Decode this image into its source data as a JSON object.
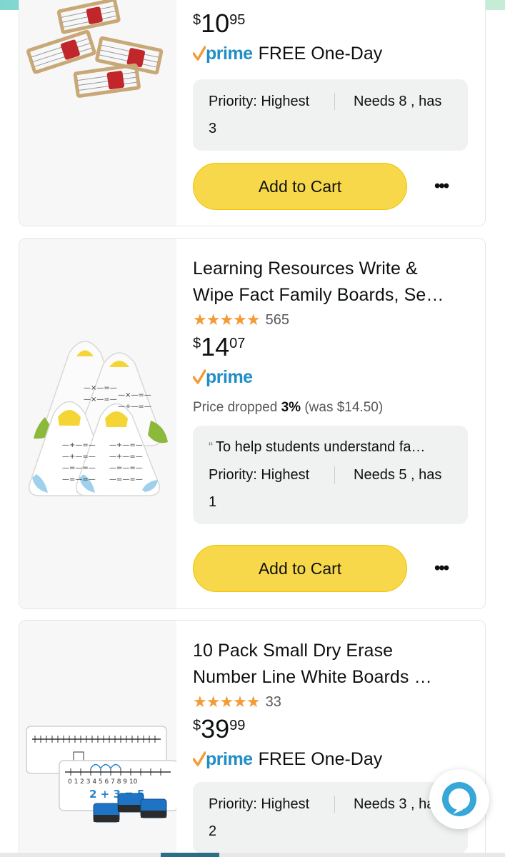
{
  "products": [
    {
      "price": {
        "symbol": "$",
        "whole": "10",
        "fraction": "95"
      },
      "prime_label": "prime",
      "delivery": "FREE One-Day",
      "details": {
        "priority": "Priority: Highest",
        "needs": "Needs 8 , has",
        "has": "3"
      },
      "add_to_cart": "Add to Cart",
      "more_icon": "ellipsis-icon"
    },
    {
      "title_line1": "Learning Resources Write &",
      "title_line2": "Wipe Fact Family Boards, Se…",
      "rating_stars": "★★★★★",
      "rating_value": 4.7,
      "rating_count": "565",
      "price": {
        "symbol": "$",
        "whole": "14",
        "fraction": "07"
      },
      "prime_label": "prime",
      "price_drop": {
        "prefix": "Price dropped ",
        "percent": "3%",
        "suffix": " (was $14.50)"
      },
      "details": {
        "quote_mark": "“",
        "quote": "To help students understand fa…",
        "priority": "Priority: Highest",
        "needs": "Needs 5 , has",
        "has": "1"
      },
      "add_to_cart": "Add to Cart",
      "more_icon": "ellipsis-icon"
    },
    {
      "title_line1": "10 Pack Small Dry Erase",
      "title_line2": "Number Line White Boards …",
      "rating_stars": "★★★★★",
      "rating_value": 4.7,
      "rating_count": "33",
      "price": {
        "symbol": "$",
        "whole": "39",
        "fraction": "99"
      },
      "prime_label": "prime",
      "delivery": "FREE One-Day",
      "details": {
        "priority": "Priority: Highest",
        "needs": "Needs 3 , ha",
        "has": "2"
      }
    }
  ],
  "number_line_labels": "0 1 2 3 4 5 6 7 8 9 10",
  "number_line_equation": "2 + 3 = 5",
  "colors": {
    "accent_yellow": "#f7d84a",
    "prime_blue": "#1f8ec6",
    "prime_check": "#f39c37",
    "star": "#f39c37",
    "alexa_blue": "#36a7d7"
  },
  "alexa_icon": "alexa-icon"
}
